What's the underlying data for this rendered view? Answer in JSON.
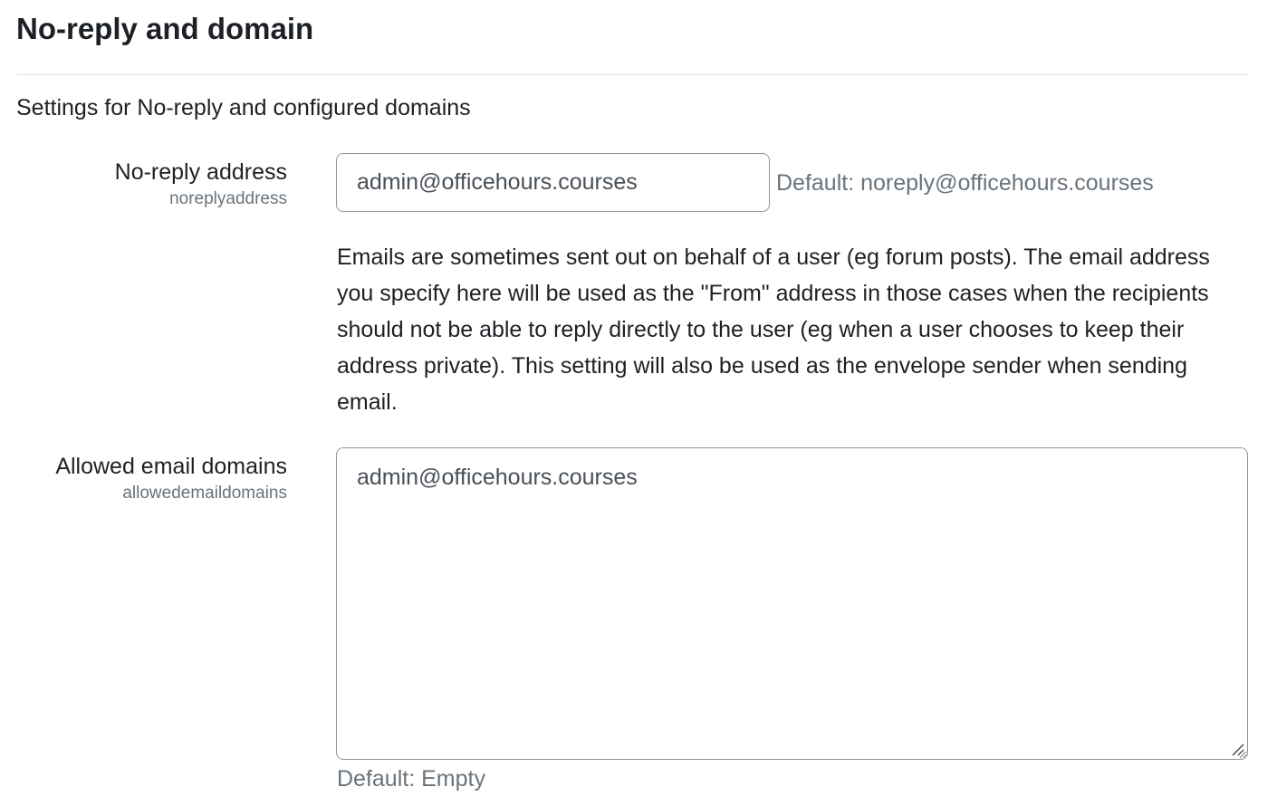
{
  "section": {
    "title": "No-reply and domain",
    "description": "Settings for No-reply and configured domains"
  },
  "noreply": {
    "label": "No-reply address",
    "key": "noreplyaddress",
    "value": "admin@officehours.courses",
    "default_text": "Default: noreply@officehours.courses",
    "help": "Emails are sometimes sent out on behalf of a user (eg forum posts). The email address you specify here will be used as the \"From\" address in those cases when the recipients should not be able to reply directly to the user (eg when a user chooses to keep their address private). This setting will also be used as the envelope sender when sending email."
  },
  "allowed_domains": {
    "label": "Allowed email domains",
    "key": "allowedemaildomains",
    "value": "admin@officehours.courses",
    "default_text": "Default: Empty"
  }
}
